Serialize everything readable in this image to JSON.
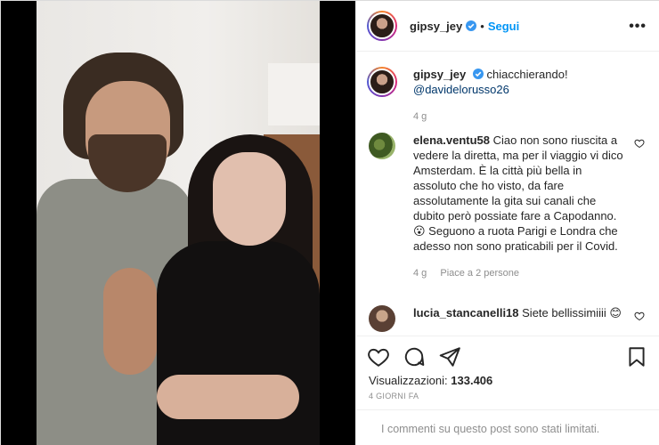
{
  "post": {
    "username": "gipsy_jey",
    "follow_label": "Segui",
    "more_icon": "more-options-icon",
    "separator": "•"
  },
  "caption": {
    "username": "gipsy_jey",
    "text": "chiacchierando!",
    "mention": "@davidelorusso26",
    "time": "4 g"
  },
  "comments": [
    {
      "username": "elena.ventu58",
      "text": "Ciao non sono riuscita a vedere la diretta, ma per il viaggio vi dico Amsterdam. È la città più bella in assoluto che ho visto, da fare assolutamente la gita sui canali che dubito però possiate fare a Capodanno. 😮 Seguono a ruota Parigi e Londra che adesso non sono praticabili per il Covid.",
      "time": "4 g",
      "likes": "Piace a 2 persone"
    },
    {
      "username": "lucia_stancanelli18",
      "text": "Siete bellissimiiii 😊"
    }
  ],
  "stats": {
    "views_label": "Visualizzazioni:",
    "views_value": "133.406",
    "date": "4 GIORNI FA"
  },
  "footer": {
    "limited_text": "I commenti su questo post sono stati limitati."
  },
  "colors": {
    "accent": "#0095f6",
    "text": "#262626",
    "muted": "#8e8e8e",
    "mention": "#00376b"
  }
}
